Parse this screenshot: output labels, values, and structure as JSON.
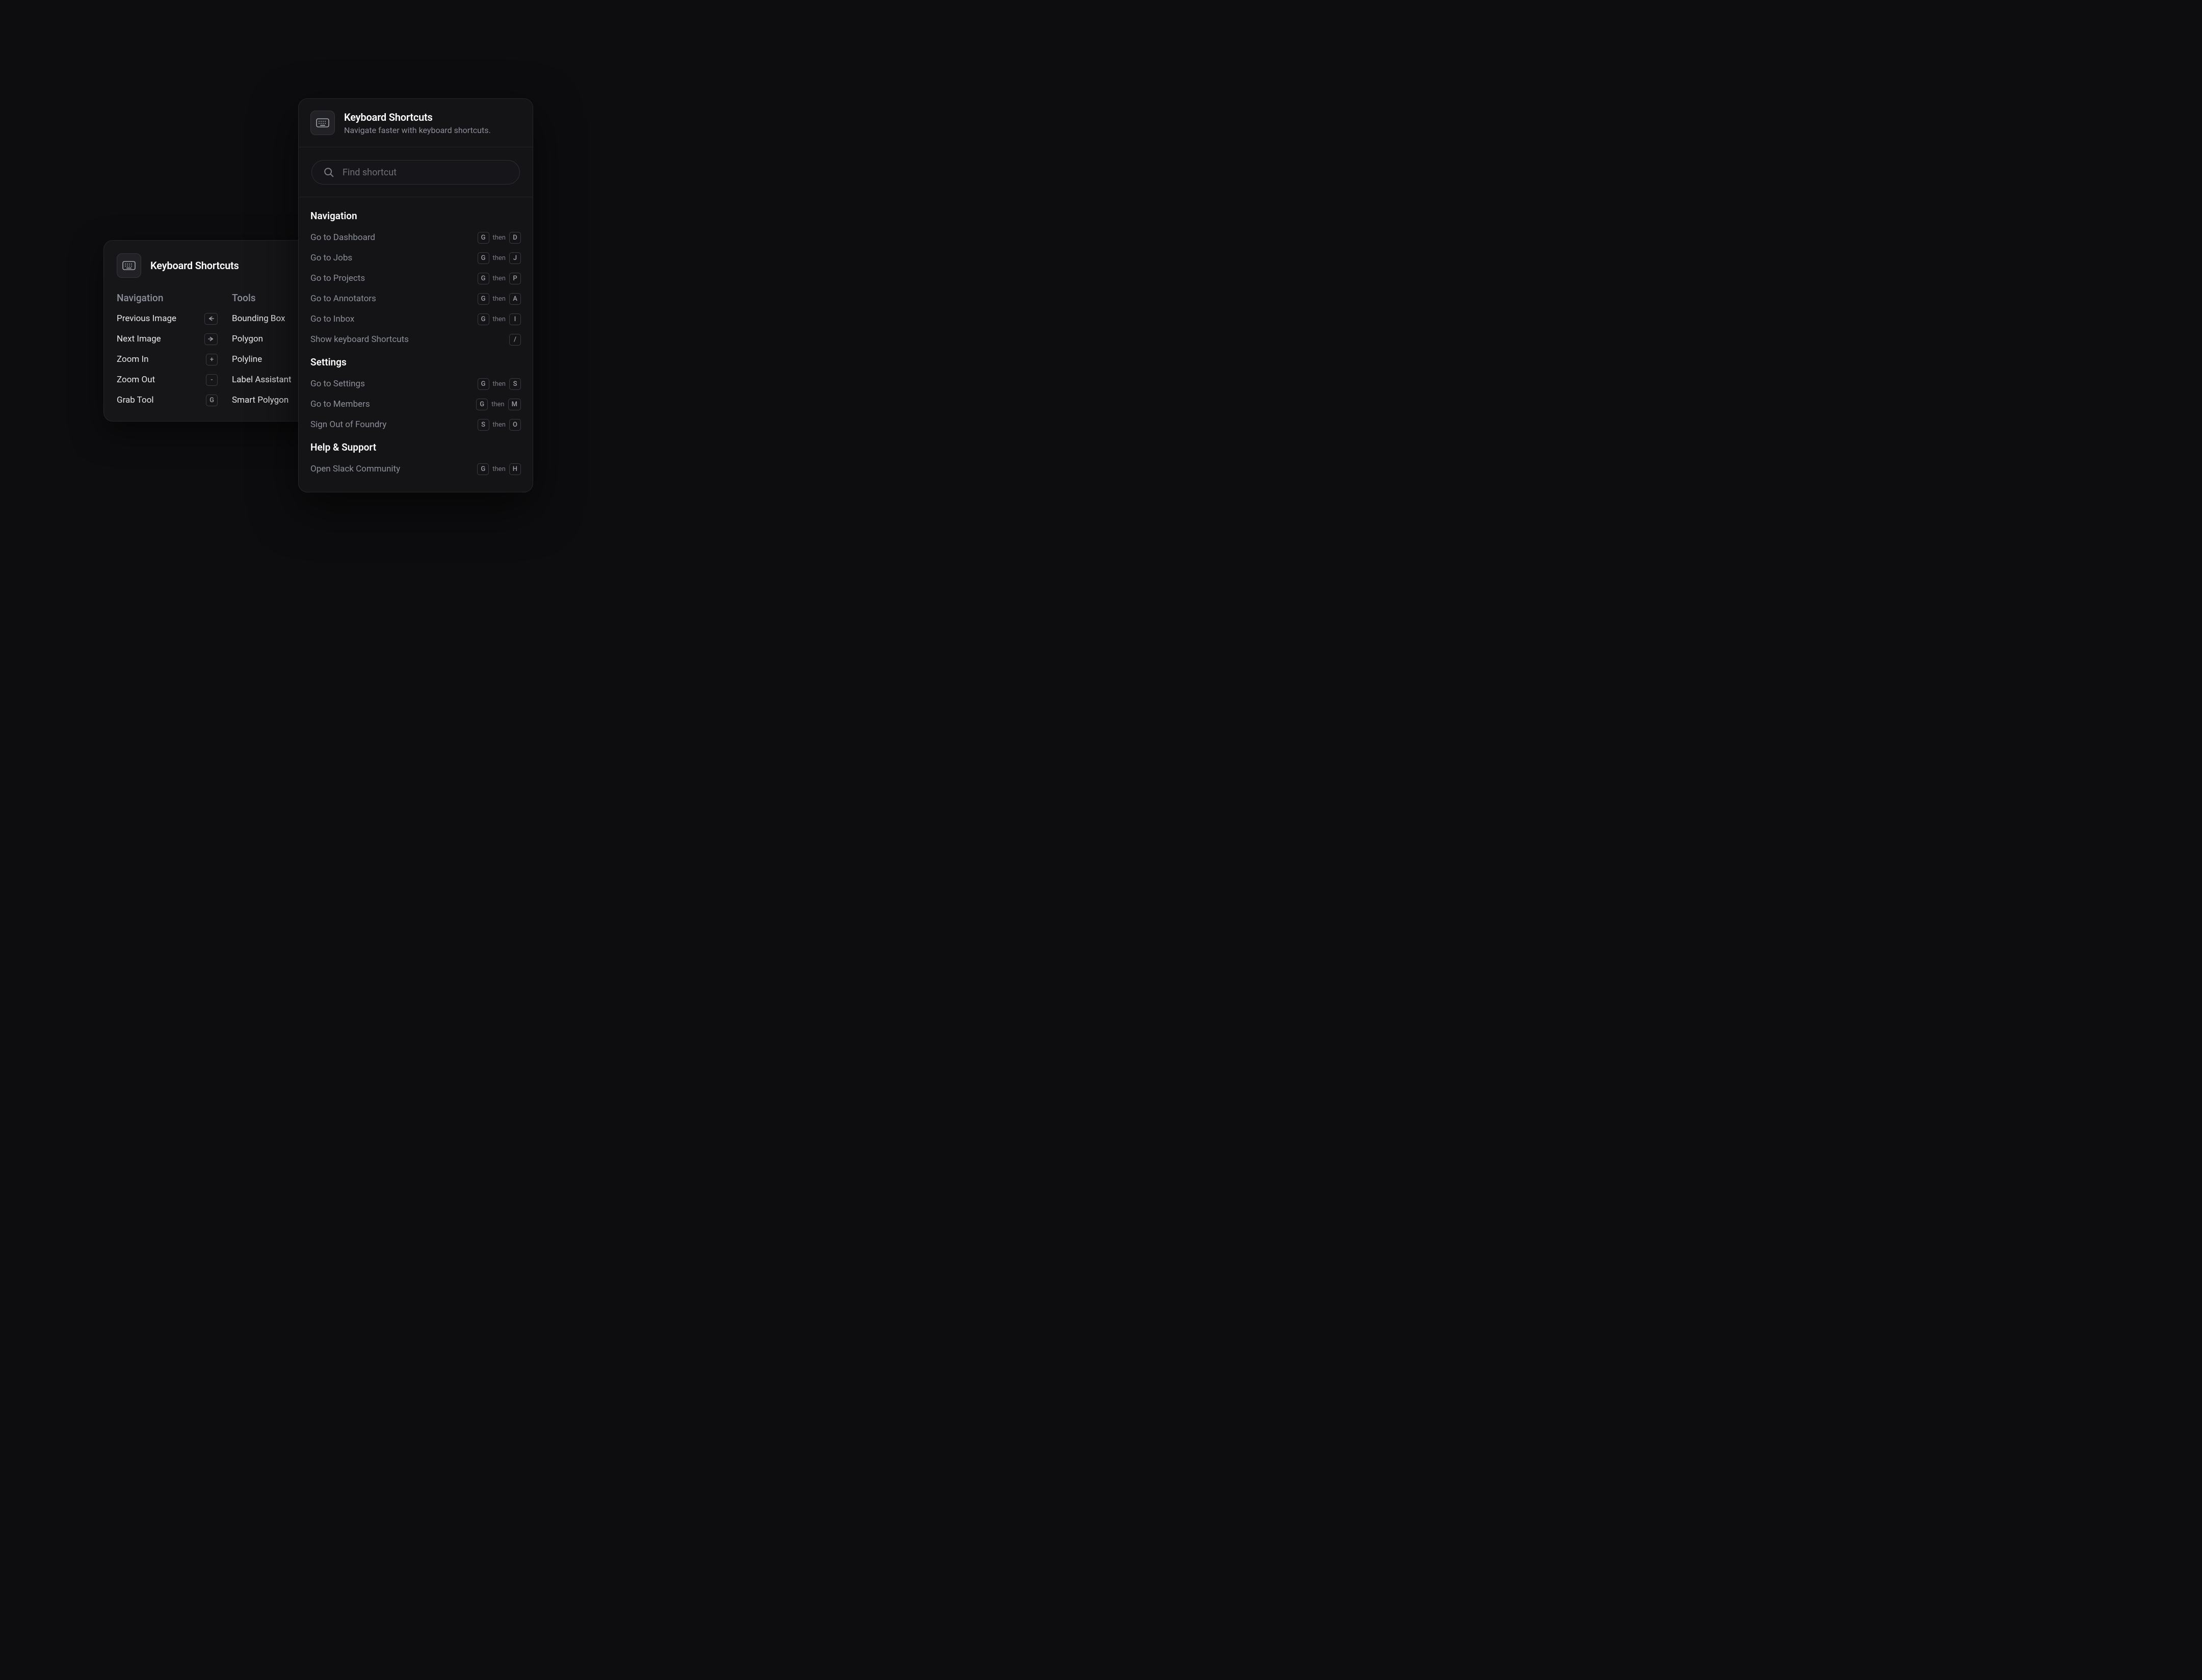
{
  "panel_back": {
    "title": "Keyboard Shortcuts",
    "columns": {
      "navigation": {
        "title": "Navigation",
        "items": [
          {
            "label": "Previous Image",
            "key": "←"
          },
          {
            "label": "Next Image",
            "key": "→"
          },
          {
            "label": "Zoom In",
            "key": "+"
          },
          {
            "label": "Zoom Out",
            "key": "-"
          },
          {
            "label": "Grab Tool",
            "key": "G"
          }
        ]
      },
      "tools": {
        "title": "Tools",
        "items": [
          {
            "label": "Bounding Box"
          },
          {
            "label": "Polygon"
          },
          {
            "label": "Polyline"
          },
          {
            "label": "Label Assistant"
          },
          {
            "label": "Smart Polygon"
          }
        ]
      }
    }
  },
  "panel_front": {
    "title": "Keyboard Shortcuts",
    "subtitle": "Navigate faster with keyboard shortcuts.",
    "search_placeholder": "Find shortcut",
    "then_label": "then",
    "sections": [
      {
        "title": "Navigation",
        "items": [
          {
            "label": "Go to Dashboard",
            "keys": [
              "G",
              "D"
            ]
          },
          {
            "label": "Go to Jobs",
            "keys": [
              "G",
              "J"
            ]
          },
          {
            "label": "Go to Projects",
            "keys": [
              "G",
              "P"
            ]
          },
          {
            "label": "Go to Annotators",
            "keys": [
              "G",
              "A"
            ]
          },
          {
            "label": "Go to Inbox",
            "keys": [
              "G",
              "I"
            ]
          },
          {
            "label": "Show keyboard Shortcuts",
            "keys": [
              "/"
            ]
          }
        ]
      },
      {
        "title": "Settings",
        "items": [
          {
            "label": "Go to Settings",
            "keys": [
              "G",
              "S"
            ]
          },
          {
            "label": "Go to Members",
            "keys": [
              "G",
              "M"
            ]
          },
          {
            "label": "Sign Out of Foundry",
            "keys": [
              "S",
              "O"
            ]
          }
        ]
      },
      {
        "title": "Help & Support",
        "items": [
          {
            "label": "Open Slack Community",
            "keys": [
              "G",
              "H"
            ]
          }
        ]
      }
    ]
  }
}
